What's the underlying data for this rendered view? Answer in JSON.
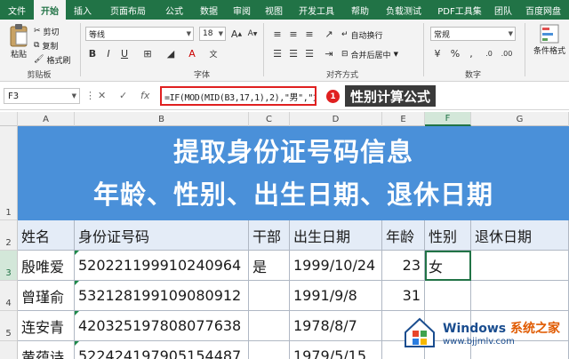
{
  "tabs": [
    "文件",
    "开始",
    "插入",
    "页面布局",
    "公式",
    "数据",
    "审阅",
    "视图",
    "开发工具",
    "帮助",
    "负载测试",
    "PDF工具集",
    "团队",
    "百度网盘"
  ],
  "active_tab": 1,
  "ribbon": {
    "clipboard": {
      "paste": "粘贴",
      "cut": "剪切",
      "copy": "复制",
      "format_painter": "格式刷",
      "label": "剪贴板"
    },
    "font": {
      "name": "等线",
      "size": "18",
      "label": "字体"
    },
    "alignment": {
      "wrap": "自动换行",
      "merge": "合并后居中",
      "label": "对齐方式"
    },
    "number": {
      "format": "常规",
      "label": "数字"
    },
    "styles": {
      "conditional": "条件格式"
    }
  },
  "formula_bar": {
    "name_box": "F3",
    "formula": "=IF(MOD(MID(B3,17,1),2),\"男\",\"女\")",
    "badge": "1",
    "callout": "性别计算公式"
  },
  "grid": {
    "columns": [
      "A",
      "B",
      "C",
      "D",
      "E",
      "F",
      "G"
    ],
    "rows": [
      "1",
      "2",
      "3",
      "4",
      "5",
      "6"
    ],
    "banner_line1": "提取身份证号码信息",
    "banner_line2": "年龄、性别、出生日期、退休日期",
    "headers": [
      "姓名",
      "身份证号码",
      "干部",
      "出生日期",
      "年龄",
      "性别",
      "退休日期"
    ],
    "data": [
      [
        "殷唯爱",
        "520221199910240964",
        "是",
        "1999/10/24",
        "23",
        "女",
        ""
      ],
      [
        "曾瑾俞",
        "532128199109080912",
        "",
        "1991/9/8",
        "31",
        "",
        ""
      ],
      [
        "连安青",
        "420325197808077638",
        "",
        "1978/8/7",
        "",
        "",
        ""
      ],
      [
        "黄蕴诗",
        "522424197905154487",
        "",
        "1979/5/15",
        "",
        "",
        ""
      ]
    ]
  },
  "watermark": {
    "brand_a": "Windows",
    "brand_b": " 系统之家",
    "url": "www.bjjmlv.com"
  },
  "colors": {
    "excel_green": "#217346",
    "banner_blue": "#4a90d9",
    "highlight_red": "#e02020"
  }
}
